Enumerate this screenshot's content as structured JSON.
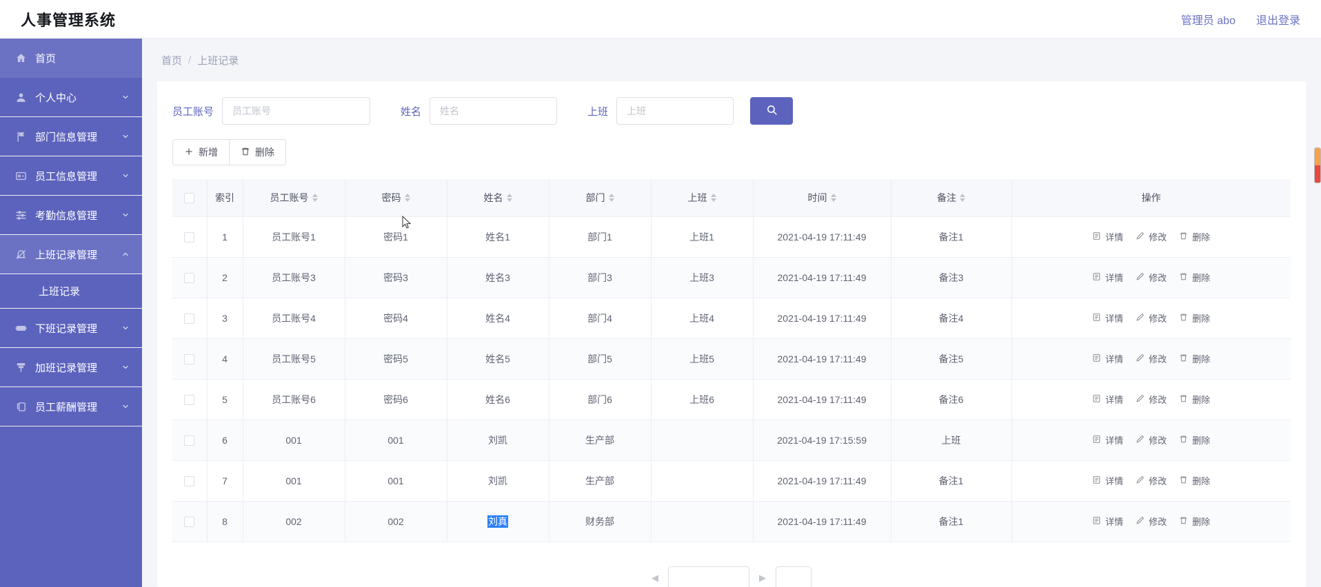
{
  "header": {
    "brand": "人事管理系统",
    "admin_label": "管理员 abo",
    "logout_label": "退出登录"
  },
  "sidebar": {
    "items": [
      {
        "label": "首页",
        "icon": "home-icon",
        "expandable": false,
        "active": true,
        "expanded": false
      },
      {
        "label": "个人中心",
        "icon": "user-icon",
        "expandable": true,
        "active": false,
        "expanded": false
      },
      {
        "label": "部门信息管理",
        "icon": "flag-icon",
        "expandable": true,
        "active": false,
        "expanded": false
      },
      {
        "label": "员工信息管理",
        "icon": "idcard-icon",
        "expandable": true,
        "active": false,
        "expanded": false
      },
      {
        "label": "考勤信息管理",
        "icon": "sliders-icon",
        "expandable": true,
        "active": false,
        "expanded": false
      },
      {
        "label": "上班记录管理",
        "icon": "bell-off-icon",
        "expandable": true,
        "active": false,
        "expanded": true
      },
      {
        "label": "下班记录管理",
        "icon": "film-icon",
        "expandable": true,
        "active": false,
        "expanded": false
      },
      {
        "label": "加班记录管理",
        "icon": "pin-icon",
        "expandable": true,
        "active": false,
        "expanded": false
      },
      {
        "label": "员工薪酬管理",
        "icon": "copy-icon",
        "expandable": true,
        "active": false,
        "expanded": false
      }
    ],
    "submenu": {
      "parent": "上班记录管理",
      "label": "上班记录"
    }
  },
  "breadcrumb": {
    "home": "首页",
    "separator": "/",
    "current": "上班记录"
  },
  "search": {
    "fields": [
      {
        "label": "员工账号",
        "placeholder": "员工账号",
        "value": ""
      },
      {
        "label": "姓名",
        "placeholder": "姓名",
        "value": ""
      },
      {
        "label": "上班",
        "placeholder": "上班",
        "value": ""
      }
    ],
    "button_icon": "search-icon"
  },
  "toolbar": {
    "add_label": "新增",
    "add_icon": "plus-icon",
    "delete_label": "删除",
    "delete_icon": "trash-icon"
  },
  "table": {
    "columns": [
      {
        "key": "check",
        "label": "",
        "sortable": false
      },
      {
        "key": "idx",
        "label": "索引",
        "sortable": false
      },
      {
        "key": "acct",
        "label": "员工账号",
        "sortable": true
      },
      {
        "key": "pwd",
        "label": "密码",
        "sortable": true
      },
      {
        "key": "name",
        "label": "姓名",
        "sortable": true
      },
      {
        "key": "dept",
        "label": "部门",
        "sortable": true
      },
      {
        "key": "shift",
        "label": "上班",
        "sortable": true
      },
      {
        "key": "time",
        "label": "时间",
        "sortable": true
      },
      {
        "key": "remark",
        "label": "备注",
        "sortable": true
      },
      {
        "key": "op",
        "label": "操作",
        "sortable": false
      }
    ],
    "rows": [
      {
        "idx": "1",
        "acct": "员工账号1",
        "pwd": "密码1",
        "name": "姓名1",
        "dept": "部门1",
        "shift": "上班1",
        "time": "2021-04-19 17:11:49",
        "remark": "备注1",
        "selected_name": false
      },
      {
        "idx": "2",
        "acct": "员工账号3",
        "pwd": "密码3",
        "name": "姓名3",
        "dept": "部门3",
        "shift": "上班3",
        "time": "2021-04-19 17:11:49",
        "remark": "备注3",
        "selected_name": false
      },
      {
        "idx": "3",
        "acct": "员工账号4",
        "pwd": "密码4",
        "name": "姓名4",
        "dept": "部门4",
        "shift": "上班4",
        "time": "2021-04-19 17:11:49",
        "remark": "备注4",
        "selected_name": false
      },
      {
        "idx": "4",
        "acct": "员工账号5",
        "pwd": "密码5",
        "name": "姓名5",
        "dept": "部门5",
        "shift": "上班5",
        "time": "2021-04-19 17:11:49",
        "remark": "备注5",
        "selected_name": false
      },
      {
        "idx": "5",
        "acct": "员工账号6",
        "pwd": "密码6",
        "name": "姓名6",
        "dept": "部门6",
        "shift": "上班6",
        "time": "2021-04-19 17:11:49",
        "remark": "备注6",
        "selected_name": false
      },
      {
        "idx": "6",
        "acct": "001",
        "pwd": "001",
        "name": "刘凯",
        "dept": "生产部",
        "shift": "",
        "time": "2021-04-19 17:15:59",
        "remark": "上班",
        "selected_name": false
      },
      {
        "idx": "7",
        "acct": "001",
        "pwd": "001",
        "name": "刘凯",
        "dept": "生产部",
        "shift": "",
        "time": "2021-04-19 17:11:49",
        "remark": "备注1",
        "selected_name": false
      },
      {
        "idx": "8",
        "acct": "002",
        "pwd": "002",
        "name": "刘真",
        "dept": "财务部",
        "shift": "",
        "time": "2021-04-19 17:11:49",
        "remark": "备注1",
        "selected_name": true
      }
    ],
    "operations": [
      {
        "label": "详情",
        "icon": "detail-icon"
      },
      {
        "label": "修改",
        "icon": "edit-icon"
      },
      {
        "label": "删除",
        "icon": "trash-icon"
      }
    ]
  },
  "colors": {
    "sidebar": "#5c63bd",
    "sidebar_active": "#6b72c4",
    "accent": "#5c63bd",
    "selection": "#2a7ffb",
    "page_bg": "#f4f5f9"
  }
}
